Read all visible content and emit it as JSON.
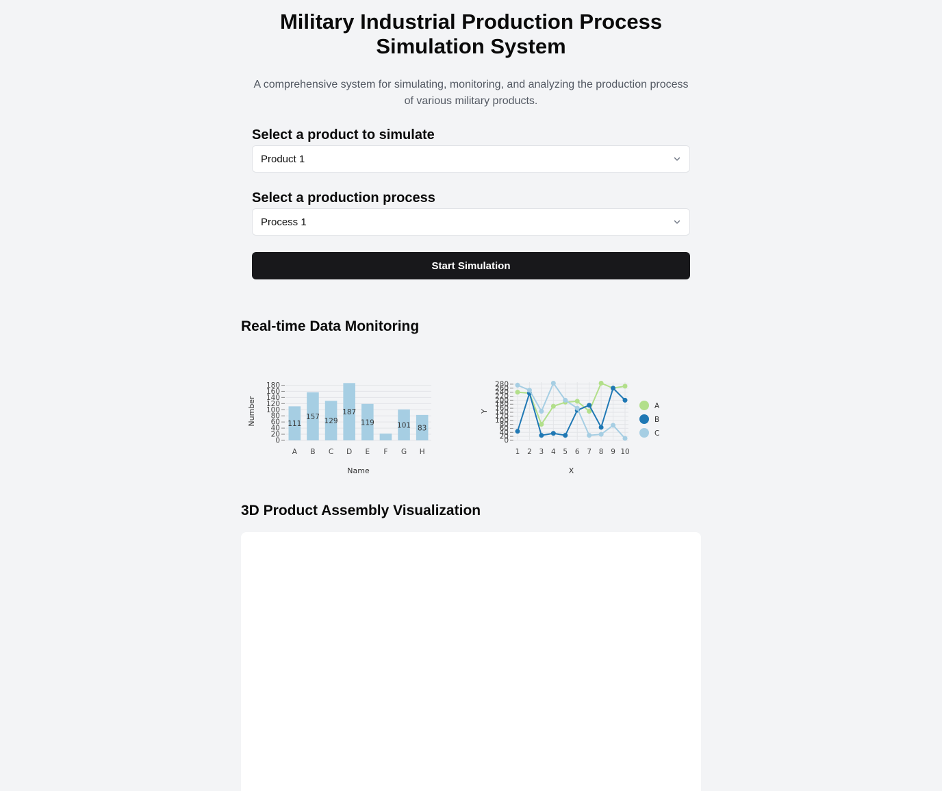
{
  "header": {
    "title": "Military Industrial Production Process Simulation System",
    "subtitle": "A comprehensive system for simulating, monitoring, and analyzing the production process of various military products."
  },
  "form": {
    "product_label": "Select a product to simulate",
    "product_value": "Product 1",
    "process_label": "Select a production process",
    "process_value": "Process 1",
    "start_button": "Start Simulation"
  },
  "monitoring": {
    "heading": "Real-time Data Monitoring"
  },
  "visualization": {
    "heading": "3D Product Assembly Visualization"
  },
  "colors": {
    "bar": "#a6cee3",
    "series_a": "#b2df8a",
    "series_b": "#1f78b4",
    "series_c": "#a6cee3",
    "button_bg": "#18181b"
  },
  "icons": {
    "product_select": "chevron-down-icon",
    "process_select": "chevron-down-icon"
  },
  "chart_data": [
    {
      "type": "bar",
      "categories": [
        "A",
        "B",
        "C",
        "D",
        "E",
        "F",
        "G",
        "H"
      ],
      "values": [
        111,
        157,
        129,
        187,
        119,
        22,
        101,
        83
      ],
      "labels": [
        "111",
        "157",
        "129",
        "187",
        "119",
        "",
        "101",
        "83"
      ],
      "xlabel": "Name",
      "ylabel": "Number",
      "ylim": [
        0,
        190
      ],
      "yticks": [
        0,
        20,
        40,
        60,
        80,
        100,
        120,
        140,
        160,
        180
      ],
      "grid": true
    },
    {
      "type": "line",
      "x": [
        1,
        2,
        3,
        4,
        5,
        6,
        7,
        8,
        9,
        10
      ],
      "series": [
        {
          "name": "A",
          "values": [
            240,
            235,
            80,
            170,
            190,
            195,
            145,
            285,
            260,
            270
          ]
        },
        {
          "name": "B",
          "values": [
            45,
            235,
            25,
            35,
            25,
            150,
            175,
            65,
            260,
            200
          ]
        },
        {
          "name": "C",
          "values": [
            275,
            250,
            145,
            285,
            200,
            160,
            25,
            30,
            75,
            10
          ]
        }
      ],
      "xlabel": "X",
      "ylabel": "Y",
      "ylim": [
        0,
        290
      ],
      "yticks": [
        0,
        20,
        40,
        60,
        80,
        100,
        120,
        140,
        160,
        180,
        200,
        220,
        240,
        260,
        280
      ],
      "grid": true,
      "legend": "right"
    }
  ]
}
